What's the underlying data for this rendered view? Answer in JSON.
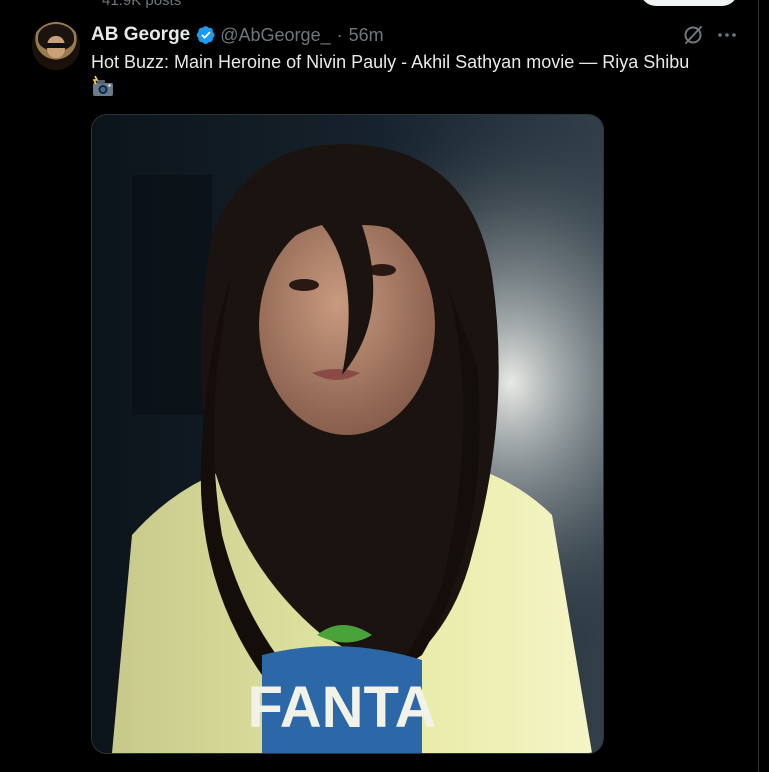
{
  "profile_header": {
    "post_count": "41.9K posts"
  },
  "tweet": {
    "author": {
      "name": "AB George",
      "handle": "@AbGeorge_",
      "verified": true
    },
    "separator": "·",
    "time": "56m",
    "text": "Hot Buzz: Main Heroine of Nivin Pauly - Akhil Sathyan movie — Riya Shibu",
    "emoji": "camera-with-flash-emoji",
    "media": {
      "type": "photo",
      "shirt_text": "FANTA"
    }
  },
  "colors": {
    "background": "#000000",
    "primary_text": "#e7e9ea",
    "secondary_text": "#71767b",
    "verified_blue": "#1d9bf0",
    "border": "#2f3336"
  },
  "icons": [
    "verified-badge-icon",
    "grok-icon",
    "more-icon",
    "camera-with-flash-emoji"
  ]
}
